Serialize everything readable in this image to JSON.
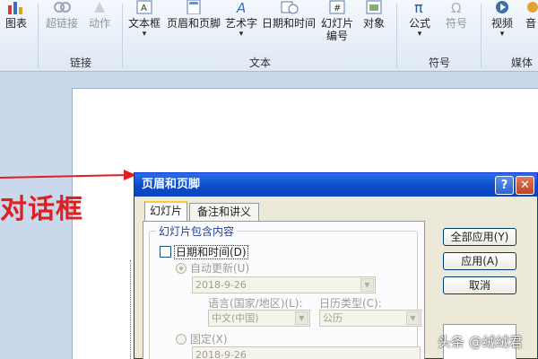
{
  "ribbon": {
    "buttons": [
      {
        "label": "图表",
        "icon": "chart-icon",
        "disabled": false
      },
      {
        "label": "超链接",
        "icon": "hyperlink-icon",
        "disabled": true
      },
      {
        "label": "动作",
        "icon": "action-icon",
        "disabled": true
      },
      {
        "label": "文本框",
        "icon": "textbox-icon",
        "disabled": false
      },
      {
        "label": "页眉和页脚",
        "icon": "header-footer-icon",
        "disabled": false
      },
      {
        "label": "艺术字",
        "icon": "wordart-icon",
        "disabled": false
      },
      {
        "label": "日期和时间",
        "icon": "date-time-icon",
        "disabled": false
      },
      {
        "label": "幻灯片",
        "label2": "编号",
        "icon": "slide-number-icon",
        "disabled": false
      },
      {
        "label": "对象",
        "icon": "object-icon",
        "disabled": false
      },
      {
        "label": "公式",
        "icon": "equation-icon",
        "disabled": false
      },
      {
        "label": "符号",
        "icon": "symbol-icon",
        "disabled": true
      },
      {
        "label": "视频",
        "icon": "video-icon",
        "disabled": false
      },
      {
        "label": "音",
        "icon": "audio-icon",
        "disabled": false
      }
    ],
    "groups": [
      "链接",
      "文本",
      "符号",
      "媒体"
    ]
  },
  "annotation": {
    "text": "对话框",
    "color": "#e02020"
  },
  "dialog": {
    "title": "页眉和页脚",
    "help_glyph": "?",
    "close_glyph": "✕",
    "tabs": [
      "幻灯片",
      "备注和讲义"
    ],
    "legend": "幻灯片包含内容",
    "date_time_label": "日期和时间(D)",
    "auto_update_label": "自动更新(U)",
    "auto_update_value": "2018-9-26",
    "language_label": "语言(国家/地区)(L):",
    "language_value": "中文(中国)",
    "calendar_label": "日历类型(C):",
    "calendar_value": "公历",
    "fixed_label": "固定(X)",
    "fixed_value": "2018-9-26",
    "buttons": {
      "apply_all": "全部应用(Y)",
      "apply": "应用(A)",
      "cancel": "取消"
    }
  },
  "watermark": "头条 @绒绒君",
  "colors": {
    "title_bar": "#0a49c8",
    "ribbon_bg": "#dfe9f5",
    "dialog_bg": "#ece9d8"
  }
}
